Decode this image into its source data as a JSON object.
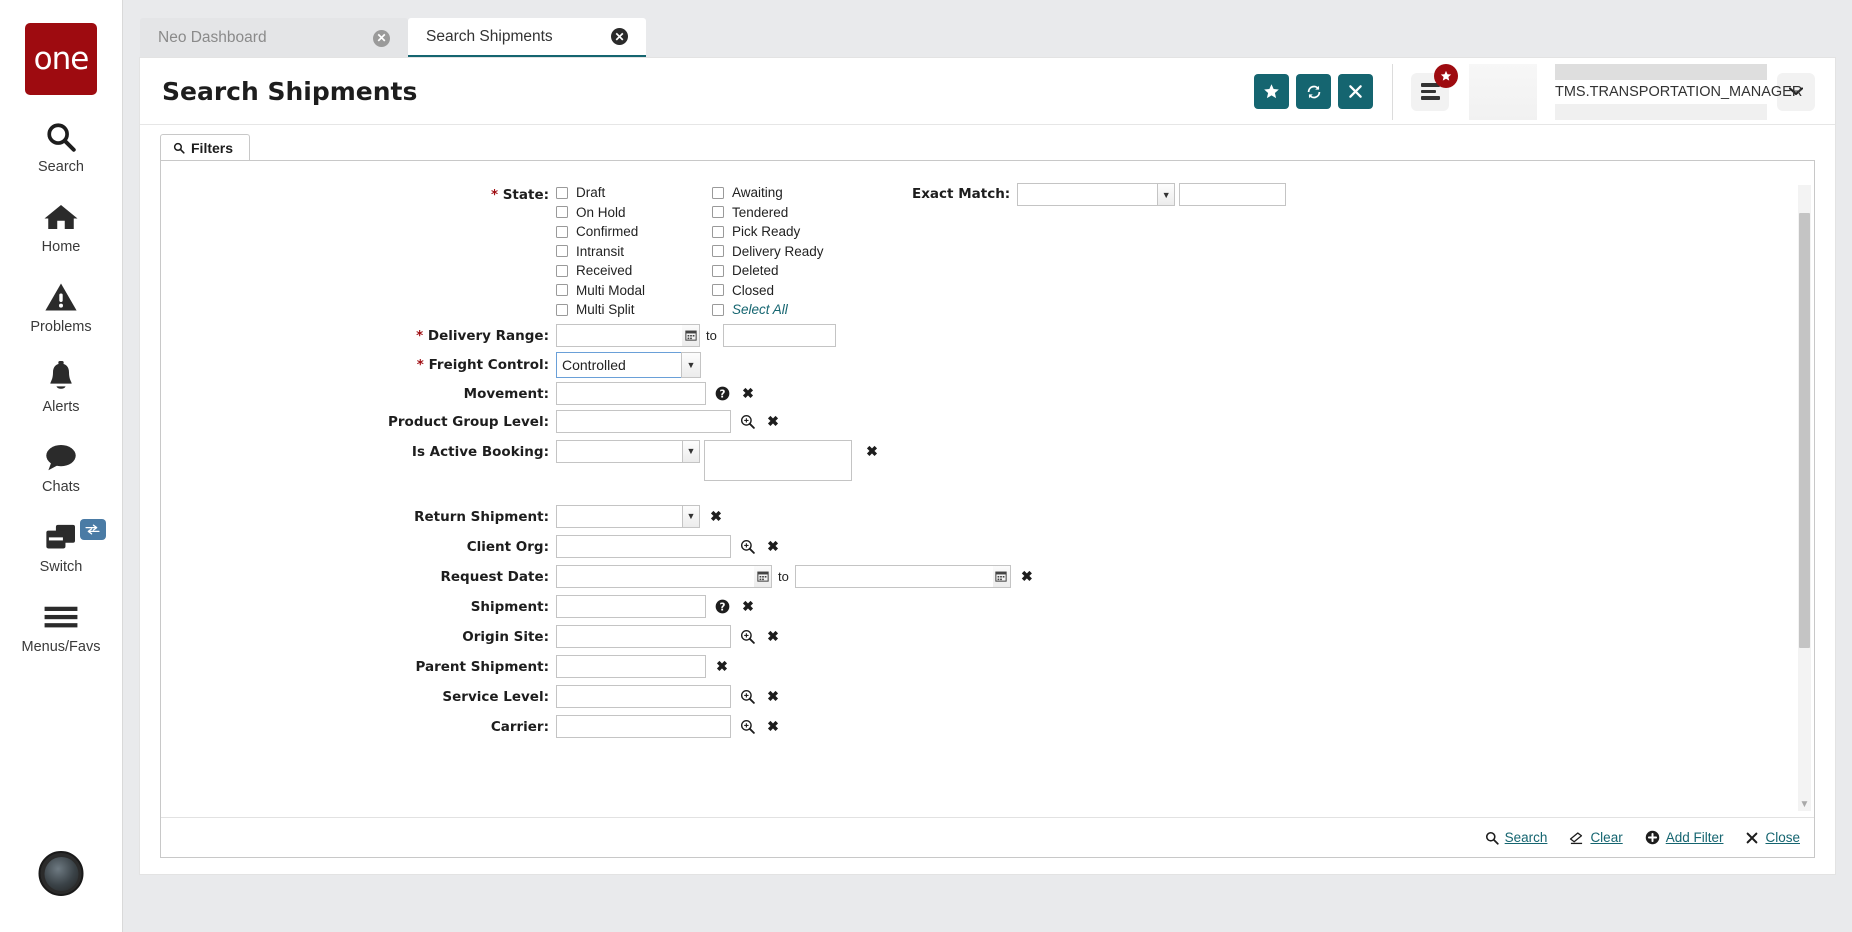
{
  "sidebar": {
    "logo_text": "one",
    "items": [
      {
        "label": "Search",
        "icon": "search-icon"
      },
      {
        "label": "Home",
        "icon": "home-icon"
      },
      {
        "label": "Problems",
        "icon": "warning-icon"
      },
      {
        "label": "Alerts",
        "icon": "bell-icon"
      },
      {
        "label": "Chats",
        "icon": "chat-icon"
      },
      {
        "label": "Switch",
        "icon": "switch-icon"
      },
      {
        "label": "Menus/Favs",
        "icon": "hamburger-icon"
      }
    ]
  },
  "tabs": [
    {
      "label": "Neo Dashboard",
      "active": false
    },
    {
      "label": "Search Shipments",
      "active": true
    }
  ],
  "header": {
    "title": "Search Shipments",
    "actions": [
      {
        "name": "favorite-button",
        "icon": "star-icon"
      },
      {
        "name": "refresh-button",
        "icon": "refresh-icon"
      },
      {
        "name": "close-button",
        "icon": "x-icon"
      }
    ],
    "menu_badge_icon": "star-icon",
    "user_name": "TMS.TRANSPORTATION_MANAGER",
    "caret": "⌄"
  },
  "filters": {
    "tab_label": "Filters",
    "state": {
      "label": "State:",
      "required": true,
      "column1": [
        "Draft",
        "On Hold",
        "Confirmed",
        "Intransit",
        "Received",
        "Multi Modal",
        "Multi Split"
      ],
      "column2": [
        "Awaiting",
        "Tendered",
        "Pick Ready",
        "Delivery Ready",
        "Deleted",
        "Closed",
        "Select All"
      ]
    },
    "exact_match": {
      "label": "Exact Match:",
      "select_value": "",
      "text_value": ""
    },
    "rows": [
      {
        "label": "Delivery Range:",
        "required": true,
        "type": "date-range",
        "value": "",
        "value2": "",
        "to": "to"
      },
      {
        "label": "Freight Control:",
        "required": true,
        "type": "select",
        "value": "Controlled"
      },
      {
        "label": "Movement:",
        "required": false,
        "type": "text-help",
        "value": ""
      },
      {
        "label": "Product Group Level:",
        "required": false,
        "type": "text-search",
        "value": ""
      },
      {
        "label": "Is Active Booking:",
        "required": false,
        "type": "select-box",
        "value": "",
        "value2": ""
      },
      {
        "label": "Return Shipment:",
        "required": false,
        "type": "select-clear",
        "value": ""
      },
      {
        "label": "Client Org:",
        "required": false,
        "type": "text-search",
        "value": ""
      },
      {
        "label": "Request Date:",
        "required": false,
        "type": "date-range-clear",
        "value": "",
        "value2": "",
        "to": "to"
      },
      {
        "label": "Shipment:",
        "required": false,
        "type": "text-help",
        "value": ""
      },
      {
        "label": "Origin Site:",
        "required": false,
        "type": "text-search",
        "value": ""
      },
      {
        "label": "Parent Shipment:",
        "required": false,
        "type": "text-clear",
        "value": ""
      },
      {
        "label": "Service Level:",
        "required": false,
        "type": "text-search",
        "value": ""
      },
      {
        "label": "Carrier:",
        "required": false,
        "type": "text-search",
        "value": ""
      }
    ],
    "footer_links": [
      {
        "label": "Search",
        "icon": "search-icon"
      },
      {
        "label": "Clear",
        "icon": "eraser-icon"
      },
      {
        "label": "Add Filter",
        "icon": "plus-circle-icon"
      },
      {
        "label": "Close",
        "icon": "x-icon"
      }
    ]
  },
  "colors": {
    "brand_red": "#9e0b10",
    "accent_teal": "#156570",
    "required_star": "#9e0b10"
  }
}
